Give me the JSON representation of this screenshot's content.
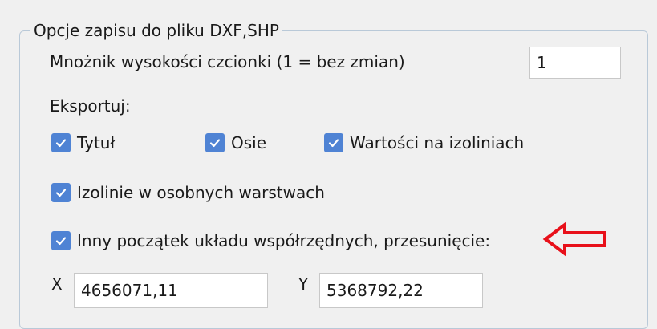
{
  "group": {
    "title": "Opcje zapisu do pliku DXF,SHP"
  },
  "font_multiplier": {
    "label": "Mnożnik wysokości czcionki (1 = bez zmian)",
    "value": "1"
  },
  "export": {
    "label": "Eksportuj:",
    "title_checkbox": {
      "label": "Tytuł",
      "checked": true
    },
    "axes_checkbox": {
      "label": "Osie",
      "checked": true
    },
    "values_checkbox": {
      "label": "Wartości na izoliniach",
      "checked": true
    }
  },
  "isolines_layers": {
    "label": "Izolinie w osobnych warstwach",
    "checked": true
  },
  "origin_offset": {
    "label": "Inny początek układu współrzędnych, przesunięcie:",
    "checked": true
  },
  "offset_x": {
    "label": "X",
    "value": "4656071,11"
  },
  "offset_y": {
    "label": "Y",
    "value": "5368792,22"
  },
  "colors": {
    "checkbox": "#4f83d4",
    "arrow": "#e8101a",
    "group_border": "#b9c9d8"
  },
  "icons": {
    "checkmark": "check-icon",
    "pointer": "left-arrow-icon"
  }
}
